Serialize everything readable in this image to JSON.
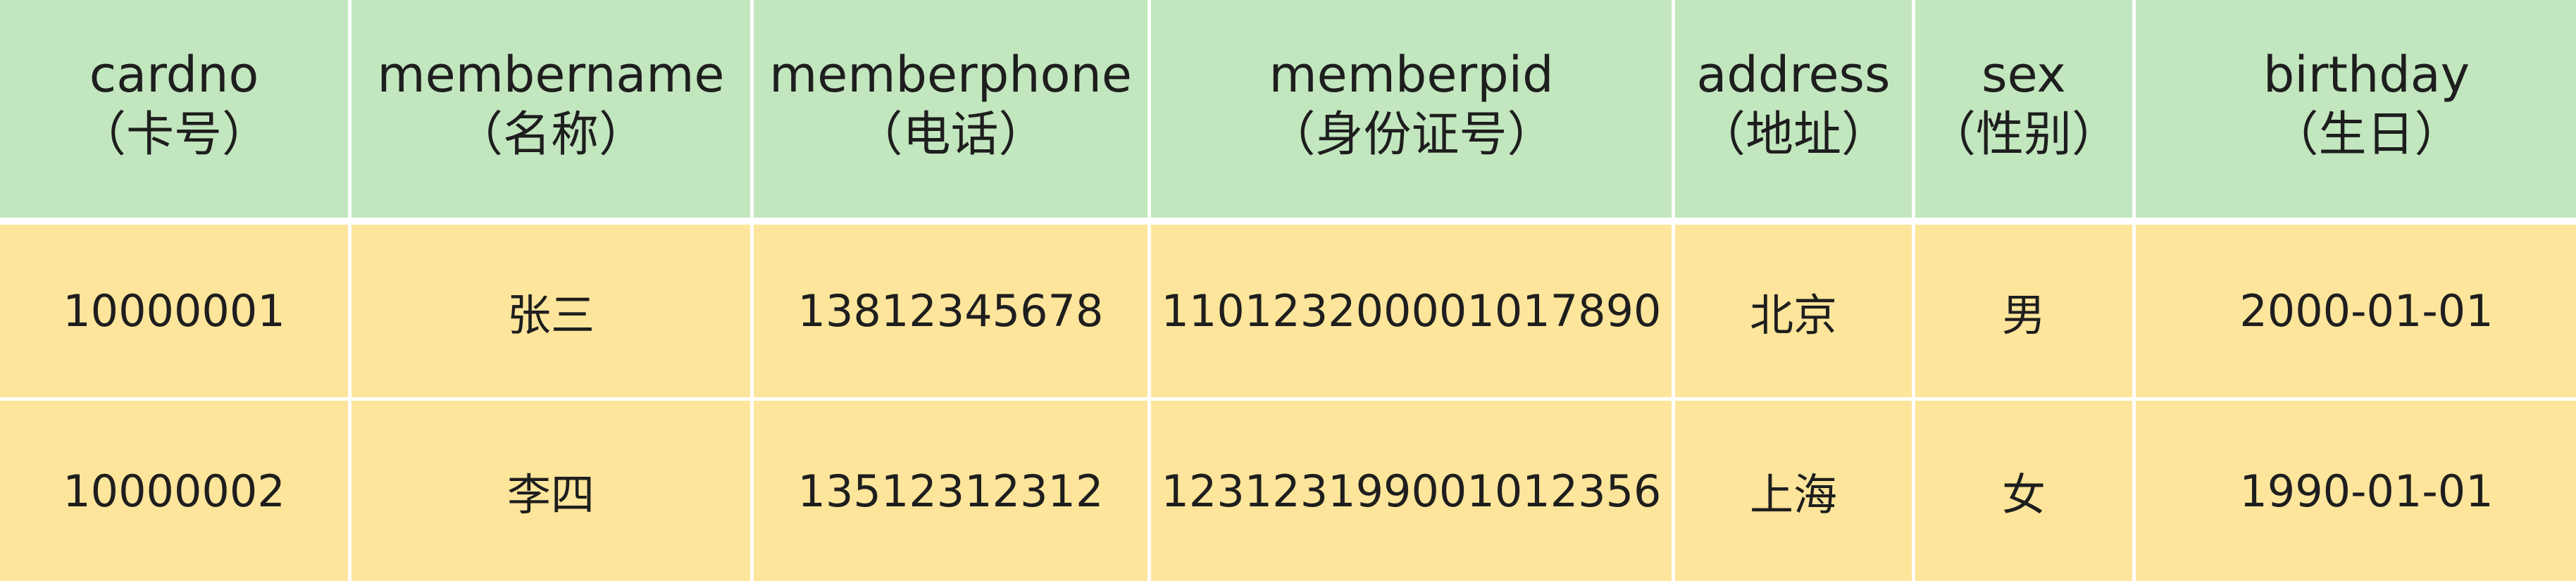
{
  "table": {
    "headers": [
      {
        "en": "cardno",
        "cn": "（卡号）"
      },
      {
        "en": "membername",
        "cn": "（名称）"
      },
      {
        "en": "memberphone",
        "cn": "（电话）"
      },
      {
        "en": "memberpid",
        "cn": "（身份证号）"
      },
      {
        "en": "address",
        "cn": "（地址）"
      },
      {
        "en": "sex",
        "cn": "（性别）"
      },
      {
        "en": "birthday",
        "cn": "（生日）"
      }
    ],
    "rows": [
      [
        "10000001",
        "张三",
        "13812345678",
        "110123200001017890",
        "北京",
        "男",
        "2000-01-01"
      ],
      [
        "10000002",
        "李四",
        "13512312312",
        "123123199001012356",
        "上海",
        "女",
        "1990-01-01"
      ]
    ]
  },
  "colors": {
    "header_bg": "#c2e6be",
    "row_bg": "#fde59b",
    "divider": "#ffffff"
  }
}
